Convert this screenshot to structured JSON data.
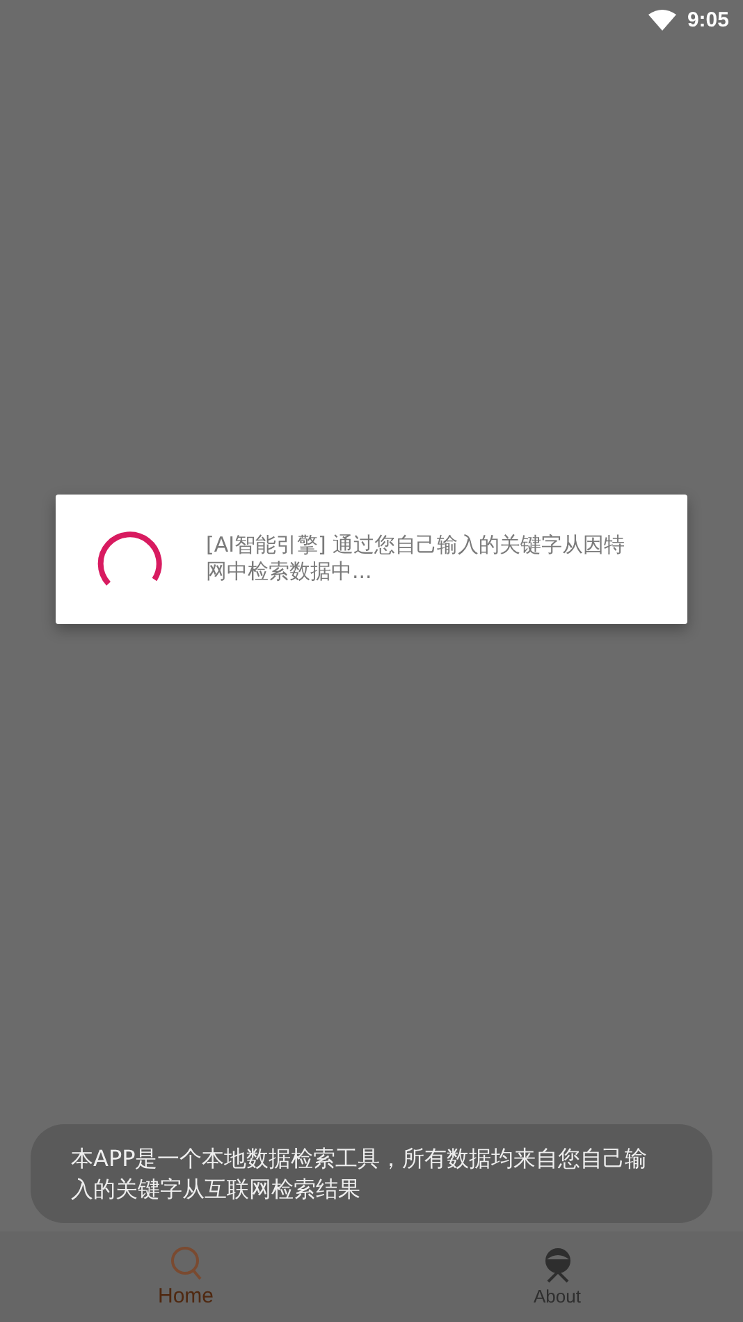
{
  "status_bar": {
    "time": "9:05"
  },
  "dialog": {
    "message": "[AI智能引擎]  通过您自己输入的关键字从因特网中检索数据中..."
  },
  "toast": {
    "message": "本APP是一个本地数据检索工具，所有数据均来自您自己输入的关键字从互联网检索结果"
  },
  "bottom_nav": [
    {
      "label": "Home",
      "selected": true,
      "kind": "search"
    },
    {
      "label": "About",
      "selected": false,
      "kind": "person"
    }
  ]
}
